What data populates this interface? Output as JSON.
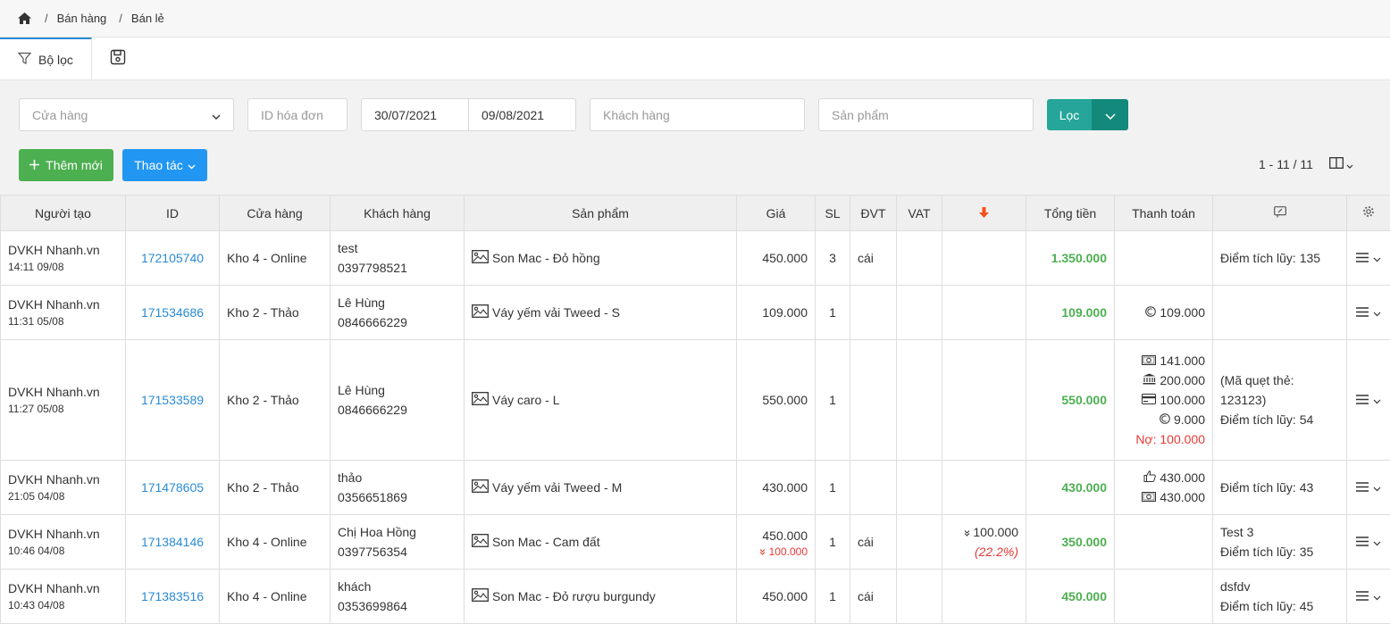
{
  "breadcrumb": {
    "items": [
      "Bán hàng",
      "Bán lẻ"
    ]
  },
  "tabs": {
    "filter_label": "Bộ lọc"
  },
  "filters": {
    "store_placeholder": "Cửa hàng",
    "invoice_id_placeholder": "ID hóa đơn",
    "date_from": "30/07/2021",
    "date_to": "09/08/2021",
    "customer_placeholder": "Khách hàng",
    "product_placeholder": "Sản phẩm",
    "filter_button": "Lọc"
  },
  "actions": {
    "add_new": "Thêm mới",
    "operations": "Thao tác"
  },
  "pager": {
    "range": "1 - 11 / 11"
  },
  "table": {
    "headers": {
      "creator": "Người tạo",
      "id": "ID",
      "store": "Cửa hàng",
      "customer": "Khách hàng",
      "product": "Sản phẩm",
      "price": "Giá",
      "qty": "SL",
      "unit": "ĐVT",
      "vat": "VAT",
      "total": "Tổng tiền",
      "payment": "Thanh toán"
    },
    "rows": [
      {
        "creator": "DVKH Nhanh.vn",
        "time": "14:11 09/08",
        "id": "172105740",
        "store": "Kho 4 - Online",
        "customer_name": "test",
        "customer_phone": "0397798521",
        "product": "Son Mac - Đỏ hồng",
        "price": "450.000",
        "price_discount": "",
        "qty": "3",
        "unit": "cái",
        "vat": "",
        "discount": "",
        "discount_pct": "",
        "total": "1.350.000",
        "payments": [],
        "debt": "",
        "note_lines": [
          "Điểm tích lũy: 135"
        ]
      },
      {
        "creator": "DVKH Nhanh.vn",
        "time": "11:31 05/08",
        "id": "171534686",
        "store": "Kho 2 - Thảo",
        "customer_name": "Lê Hùng",
        "customer_phone": "0846666229",
        "product": "Váy yếm vải Tweed - S",
        "price": "109.000",
        "price_discount": "",
        "qty": "1",
        "unit": "",
        "vat": "",
        "discount": "",
        "discount_pct": "",
        "total": "109.000",
        "payments": [
          {
            "icon": "coin-icon",
            "amount": "109.000"
          }
        ],
        "debt": "",
        "note_lines": []
      },
      {
        "creator": "DVKH Nhanh.vn",
        "time": "11:27 05/08",
        "id": "171533589",
        "store": "Kho 2 - Thảo",
        "customer_name": "Lê Hùng",
        "customer_phone": "0846666229",
        "product": "Váy caro - L",
        "price": "550.000",
        "price_discount": "",
        "qty": "1",
        "unit": "",
        "vat": "",
        "discount": "",
        "discount_pct": "",
        "total": "550.000",
        "payments": [
          {
            "icon": "cash-icon",
            "amount": "141.000"
          },
          {
            "icon": "bank-icon",
            "amount": "200.000"
          },
          {
            "icon": "card-icon",
            "amount": "100.000"
          },
          {
            "icon": "coin-icon",
            "amount": "9.000"
          }
        ],
        "debt": "Nợ: 100.000",
        "note_lines": [
          "(Mã quẹt thẻ:",
          "123123)",
          "Điểm tích lũy: 54"
        ]
      },
      {
        "creator": "DVKH Nhanh.vn",
        "time": "21:05 04/08",
        "id": "171478605",
        "store": "Kho 2 - Thảo",
        "customer_name": "thảo",
        "customer_phone": "0356651869",
        "product": "Váy yếm vải Tweed - M",
        "price": "430.000",
        "price_discount": "",
        "qty": "1",
        "unit": "",
        "vat": "",
        "discount": "",
        "discount_pct": "",
        "total": "430.000",
        "payments": [
          {
            "icon": "thumbs-up-icon",
            "amount": "430.000"
          },
          {
            "icon": "cash-icon",
            "amount": "430.000"
          }
        ],
        "debt": "",
        "note_lines": [
          "Điểm tích lũy: 43"
        ]
      },
      {
        "creator": "DVKH Nhanh.vn",
        "time": "10:46 04/08",
        "id": "171384146",
        "store": "Kho 4 - Online",
        "customer_name": "Chị Hoa Hồng",
        "customer_phone": "0397756354",
        "product": "Son Mac - Cam đất",
        "price": "450.000",
        "price_discount": "100.000",
        "qty": "1",
        "unit": "cái",
        "vat": "",
        "discount": "100.000",
        "discount_pct": "(22.2%)",
        "total": "350.000",
        "payments": [],
        "debt": "",
        "note_lines": [
          "Test 3",
          "Điểm tích lũy: 35"
        ]
      },
      {
        "creator": "DVKH Nhanh.vn",
        "time": "10:43 04/08",
        "id": "171383516",
        "store": "Kho 4 - Online",
        "customer_name": "khách",
        "customer_phone": "0353699864",
        "product": "Son Mac - Đỏ rượu burgundy",
        "price": "450.000",
        "price_discount": "",
        "qty": "1",
        "unit": "cái",
        "vat": "",
        "discount": "",
        "discount_pct": "",
        "total": "450.000",
        "payments": [],
        "debt": "",
        "note_lines": [
          "dsfdv",
          "Điểm tích lũy: 45"
        ]
      }
    ]
  }
}
